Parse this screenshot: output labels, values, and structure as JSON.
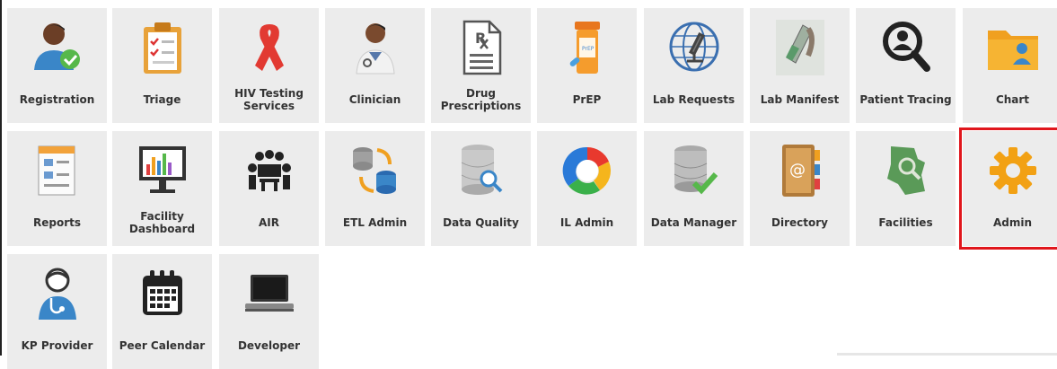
{
  "highlight_color": "#e0161c",
  "rows": [
    [
      {
        "label": "Registration",
        "icon": "person-check-icon"
      },
      {
        "label": "Triage",
        "icon": "clipboard-icon"
      },
      {
        "label": "HIV Testing Services",
        "icon": "red-ribbon-icon"
      },
      {
        "label": "Clinician",
        "icon": "doctor-icon"
      },
      {
        "label": "Drug Prescriptions",
        "icon": "prescription-icon"
      },
      {
        "label": "PrEP",
        "icon": "pill-bottle-icon"
      },
      {
        "label": "Lab Requests",
        "icon": "microscope-icon"
      },
      {
        "label": "Lab Manifest",
        "icon": "test-tube-icon"
      },
      {
        "label": "Patient Tracing",
        "icon": "search-person-icon"
      },
      {
        "label": "Chart",
        "icon": "folder-person-icon"
      }
    ],
    [
      {
        "label": "Reports",
        "icon": "report-icon"
      },
      {
        "label": "Facility Dashboard",
        "icon": "monitor-chart-icon"
      },
      {
        "label": "AIR",
        "icon": "meeting-icon"
      },
      {
        "label": "ETL Admin",
        "icon": "database-sync-icon"
      },
      {
        "label": "Data Quality",
        "icon": "database-search-icon"
      },
      {
        "label": "IL Admin",
        "icon": "il-logo-icon"
      },
      {
        "label": "Data Manager",
        "icon": "database-check-icon"
      },
      {
        "label": "Directory",
        "icon": "address-book-icon"
      },
      {
        "label": "Facilities",
        "icon": "map-search-icon"
      },
      {
        "label": "Admin",
        "icon": "gear-icon",
        "selected": true
      }
    ],
    [
      {
        "label": "KP Provider",
        "icon": "nurse-icon"
      },
      {
        "label": "Peer Calendar",
        "icon": "calendar-icon"
      },
      {
        "label": "Developer",
        "icon": "laptop-icon"
      }
    ]
  ]
}
